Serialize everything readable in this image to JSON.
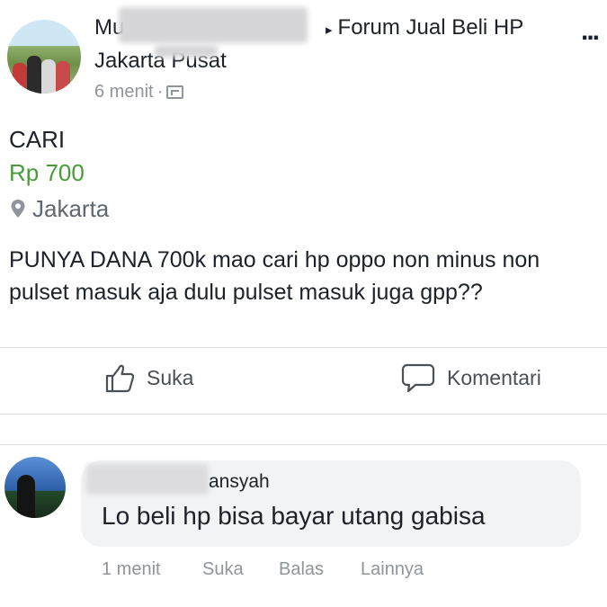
{
  "post": {
    "author_visible": "Mu",
    "group_name": "Forum Jual Beli HP",
    "more_icon": "more-horizontal-icon",
    "location": "Jakarta Pusat",
    "time": "6 menit",
    "separator": "·",
    "privacy_icon": "group-privacy-icon"
  },
  "listing": {
    "status": "CARI",
    "price": "Rp 700",
    "location": "Jakarta",
    "description": "PUNYA DANA 700k mao cari hp oppo non minus non pulset masuk aja dulu pulset masuk juga gpp??"
  },
  "actions": {
    "like": "Suka",
    "comment": "Komentari"
  },
  "comment": {
    "name_visible": "ansyah",
    "text": "Lo beli hp bisa bayar utang gabisa",
    "time": "1 menit",
    "like": "Suka",
    "reply": "Balas",
    "more": "Lainnya"
  },
  "colors": {
    "price": "#4a9a3a",
    "meta": "#90949c",
    "bubble": "#f2f3f5"
  }
}
